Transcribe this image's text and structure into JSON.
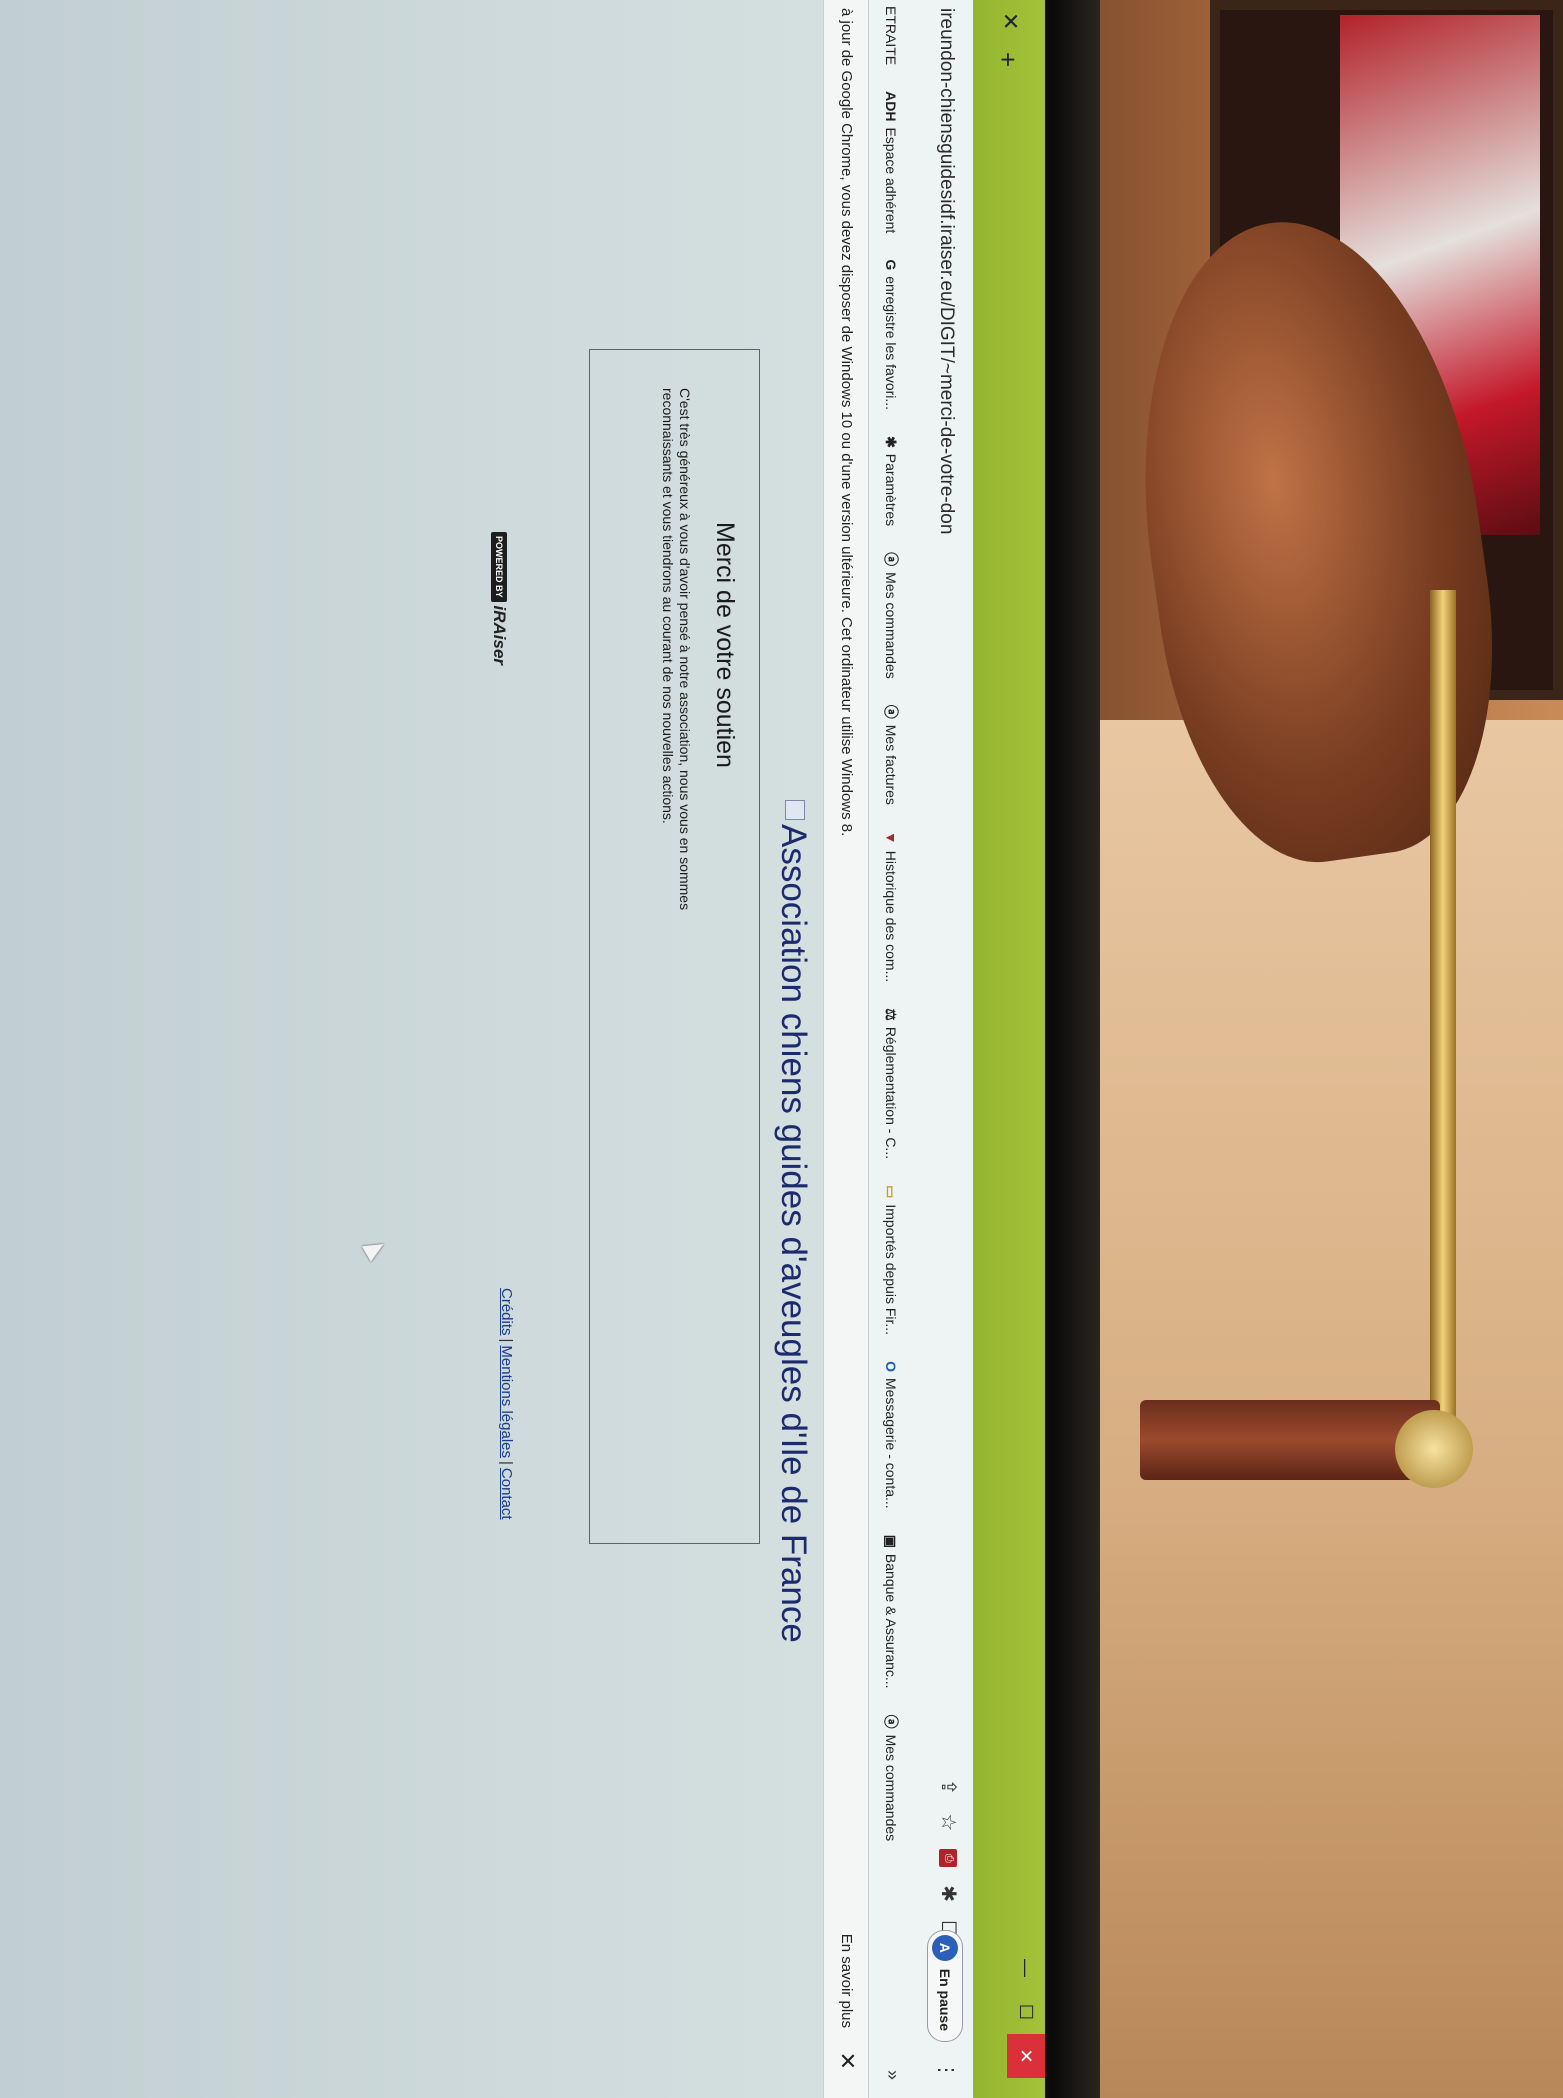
{
  "browser": {
    "url": "ireundon-chiensguidesidf.iraiser.eu/DIGIT/~merci-de-votre-don",
    "window_controls": {
      "minimize": "—",
      "maximize": "☐",
      "close": "✕"
    },
    "tab_close": "✕",
    "tab_new": "+",
    "profile": {
      "initial": "A",
      "status": "En pause"
    },
    "toolbar_icons": [
      "share-icon",
      "star-icon",
      "pdf-icon",
      "puzzle-icon",
      "square-icon"
    ],
    "menu": "⋮"
  },
  "bookmarks": [
    {
      "label": "ETRAITE",
      "icon": ""
    },
    {
      "label": "Espace adhérent",
      "icon": "ADH"
    },
    {
      "label": "enregistre les favori...",
      "icon": "G"
    },
    {
      "label": "Paramètres",
      "icon": "✱"
    },
    {
      "label": "Mes commandes",
      "icon": "ⓐ"
    },
    {
      "label": "Mes factures",
      "icon": "ⓐ"
    },
    {
      "label": "Historique des com...",
      "icon": "▼"
    },
    {
      "label": "Réglementation - C...",
      "icon": "⚖"
    },
    {
      "label": "Importés depuis Fir...",
      "icon": "▭"
    },
    {
      "label": "Messagerie - conta...",
      "icon": "O"
    },
    {
      "label": "Banque & Assuranc...",
      "icon": "▣"
    },
    {
      "label": "Mes commandes",
      "icon": "ⓐ"
    }
  ],
  "bookmarks_more": "»",
  "infobar": {
    "text": "à jour de Google Chrome, vous devez disposer de Windows 10 ou d'une version ultérieure. Cet ordinateur utilise Windows 8.",
    "more_link": "En savoir plus",
    "close": "✕"
  },
  "page": {
    "org_title": "Association chiens guides d'aveugles d'Ile de France",
    "card_title": "Merci de votre soutien",
    "card_text": "C'est très généreux à vous d'avoir pensé à notre association, nous vous en sommes reconnaissants et vous tiendrons au courant de nos nouvelles actions.",
    "powered_by_badge": "POWERED BY",
    "powered_by_brand": "iRAiser",
    "footer": {
      "credits": "Crédits",
      "legal": "Mentions légales",
      "contact": "Contact",
      "separator": "|"
    }
  },
  "colors": {
    "tabstrip": "#9fbe36",
    "title_blue": "#1c2a6e",
    "link_blue": "#1a3a8a",
    "close_red": "#d9303a"
  }
}
